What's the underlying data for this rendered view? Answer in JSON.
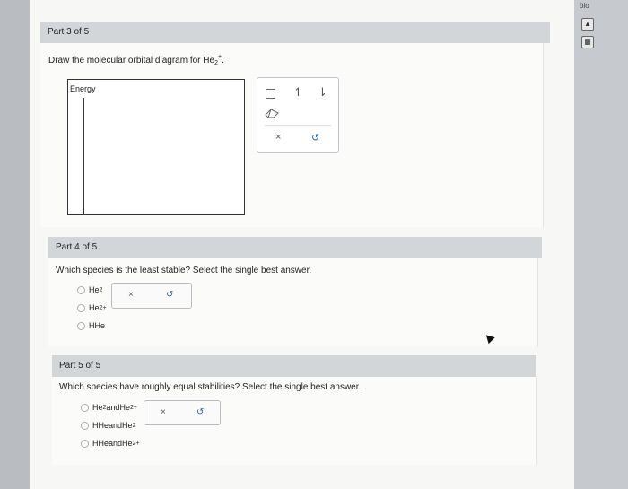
{
  "part3": {
    "header": "Part 3 of 5",
    "question_prefix": "Draw the molecular orbital diagram for ",
    "species_base": "He",
    "species_sub": "2",
    "species_sup": "+",
    "question_suffix": ".",
    "energy_label": "Energy",
    "tools": {
      "box_label": "",
      "up_arrow": "↿",
      "down_arrow": "⇂",
      "eraser": "eraser-icon",
      "clear": "×",
      "undo": "↺"
    }
  },
  "part4": {
    "header": "Part 4 of 5",
    "question": "Which species is the least stable? Select the single best answer.",
    "options": [
      {
        "base": "He",
        "sub": "2",
        "sup": ""
      },
      {
        "base": "He",
        "sub": "2",
        "sup": "+"
      },
      {
        "base": "HHe",
        "sub": "",
        "sup": ""
      }
    ],
    "clear": "×",
    "undo": "↺"
  },
  "part5": {
    "header": "Part 5 of 5",
    "question": "Which species have roughly equal stabilities? Select the single best answer.",
    "options": [
      {
        "a": "He",
        "a_sub": "2",
        "and": " and ",
        "b": "He",
        "b_sub": "2",
        "b_sup": "+"
      },
      {
        "a": "HHe",
        "a_sub": "",
        "and": " and ",
        "b": "He",
        "b_sub": "2",
        "b_sup": ""
      },
      {
        "a": "HHe",
        "a_sub": "",
        "and": " and ",
        "b": "He",
        "b_sub": "2",
        "b_sup": "+"
      }
    ],
    "clear": "×",
    "undo": "↺"
  },
  "sidebar": {
    "top_text": "ölo"
  }
}
